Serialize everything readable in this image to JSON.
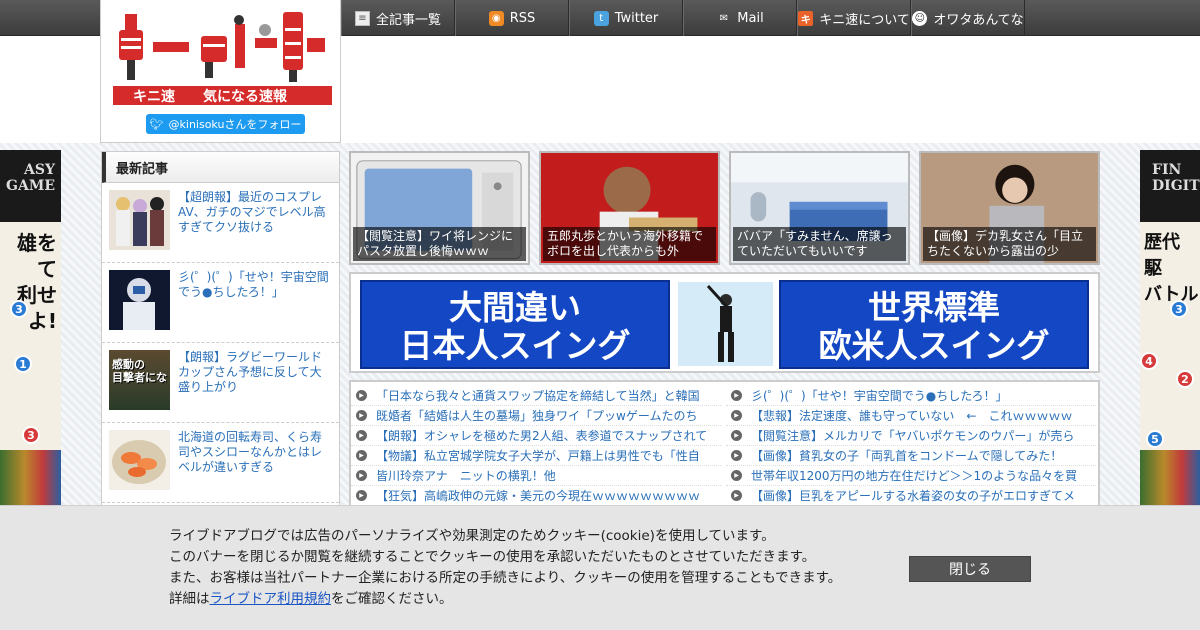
{
  "nav": {
    "items": [
      {
        "label": "全記事一覧",
        "icon": "list-icon"
      },
      {
        "label": "RSS",
        "icon": "rss-icon"
      },
      {
        "label": "Twitter",
        "icon": "twitter-icon"
      },
      {
        "label": "Mail",
        "icon": "mail-icon"
      },
      {
        "label": "キニ速について",
        "icon": "kini-icon"
      },
      {
        "label": "オワタあんてな",
        "icon": "owata-face-icon"
      }
    ]
  },
  "logo": {
    "site_name": "キニ速",
    "tagline": "気になる速報",
    "follow_button": "@kinisokuさんをフォロー"
  },
  "ads": {
    "left": {
      "title_lines": "ASY\nGAME",
      "copy": "雄を\nて\n利せよ!",
      "badges": [
        "3",
        "1",
        "3"
      ]
    },
    "right": {
      "title_lines": "FIN\nDIGIT",
      "copy": "歴代\n駆\nバトル",
      "badges": [
        "3",
        "4",
        "2",
        "5"
      ]
    }
  },
  "latest": {
    "heading": "最新記事",
    "items": [
      {
        "title": "【超朗報】最近のコスプレAV、ガチのマジでレベル高すぎてクソ抜ける"
      },
      {
        "title": "彡(゜)(゜)「せや！宇宙空間でう●ちしたろ！」"
      },
      {
        "title": "【朗報】ラグビーワールドカップさん予想に反して大盛り上がり",
        "thumb_text": "感動の\n目撃者にな"
      },
      {
        "title": "北海道の回転寿司、くら寿司やスシローなんかとはレベルが違いすぎる"
      }
    ]
  },
  "tiles": [
    {
      "caption": "【閲覧注意】ワイ将レンジにパスタ放置し後悔ｗｗｗ"
    },
    {
      "caption": "五郎丸歩とかいう海外移籍でボロを出し代表からも外"
    },
    {
      "caption": "ババア「すみません、席譲っていただいてもいいです"
    },
    {
      "caption": "【画像】デカ乳女さん「目立ちたくないから露出の少"
    }
  ],
  "golf_ad": {
    "left_text": "大間違い\n日本人スイング",
    "right_text": "世界標準\n欧米人スイング"
  },
  "links": {
    "left": [
      "「日本なら我々と通貨スワップ協定を締結して当然」と韓国",
      "既婚者「結婚は人生の墓場」独身ワイ「プッwゲームたのち",
      "【朗報】オシャレを極めた男2人組、表参道でスナップされて",
      "【物議】私立宮城学院女子大学が、戸籍上は男性でも「性自",
      "皆川玲奈アナ　ニットの横乳！他",
      "【狂気】高嶋政伸の元嫁・美元の今現在ｗｗｗｗｗｗｗｗｗ"
    ],
    "right": [
      "彡(゜)(゜)「せや！宇宙空間でう●ちしたろ！」",
      "【悲報】法定速度、誰も守っていない　←　これｗｗｗｗｗ",
      "【閲覧注意】メルカリで「ヤバいポケモンのウパー」が売ら",
      "【画像】貧乳女の子「両乳首をコンドームで隠してみた！",
      "世帯年収1200万円の地方在住だけど＞＞1のような品々を買",
      "【画像】巨乳をアピールする水着姿の女の子がエロすぎてメ"
    ]
  },
  "cookie": {
    "line1": "ライブドアブログでは広告のパーソナライズや効果測定のためクッキー(cookie)を使用しています。",
    "line2": "このバナーを閉じるか閲覧を継続することでクッキーの使用を承認いただいたものとさせていただきます。",
    "line3": "また、お客様は当社パートナー企業における所定の手続きにより、クッキーの使用を管理することもできます。",
    "line4_prefix": "詳細は",
    "line4_link": "ライブドア利用規約",
    "line4_suffix": "をご確認ください。",
    "close_label": "閉じる"
  }
}
